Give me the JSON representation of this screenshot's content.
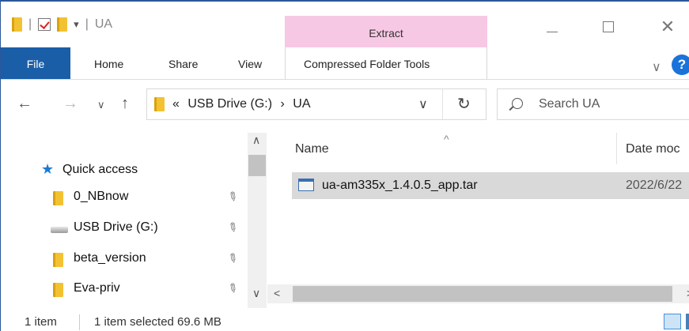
{
  "window": {
    "title": "UA",
    "quick_access_toolbar": [
      "folder-icon",
      "check-icon",
      "folder-icon",
      "dropdown"
    ],
    "context_group_label": "Extract"
  },
  "ribbon": {
    "file": "File",
    "home": "Home",
    "share": "Share",
    "view": "View",
    "context_tab": "Compressed Folder Tools"
  },
  "address": {
    "overflow": "«",
    "path": [
      "USB Drive (G:)",
      "UA"
    ],
    "separator": "›"
  },
  "search": {
    "placeholder": "Search UA"
  },
  "navpane": {
    "items": [
      {
        "label": "Quick access",
        "icon": "star-icon",
        "pinned": false
      },
      {
        "label": "0_NBnow",
        "icon": "folder-icon",
        "pinned": true
      },
      {
        "label": "USB Drive (G:)",
        "icon": "drive-icon",
        "pinned": true
      },
      {
        "label": "beta_version",
        "icon": "folder-icon",
        "pinned": true
      },
      {
        "label": "Eva-priv",
        "icon": "folder-icon",
        "pinned": true
      }
    ]
  },
  "content": {
    "columns": [
      "Name",
      "Date moc"
    ],
    "files": [
      {
        "name": "ua-am335x_1.4.0.5_app.tar",
        "date": "2022/6/22",
        "selected": true
      }
    ]
  },
  "status": {
    "count": "1 item",
    "selection": "1 item selected  69.6 MB"
  },
  "colors": {
    "file_tab": "#1a5ea8",
    "context_tab": "#f7c8e3",
    "selection": "#d9d9d9"
  }
}
